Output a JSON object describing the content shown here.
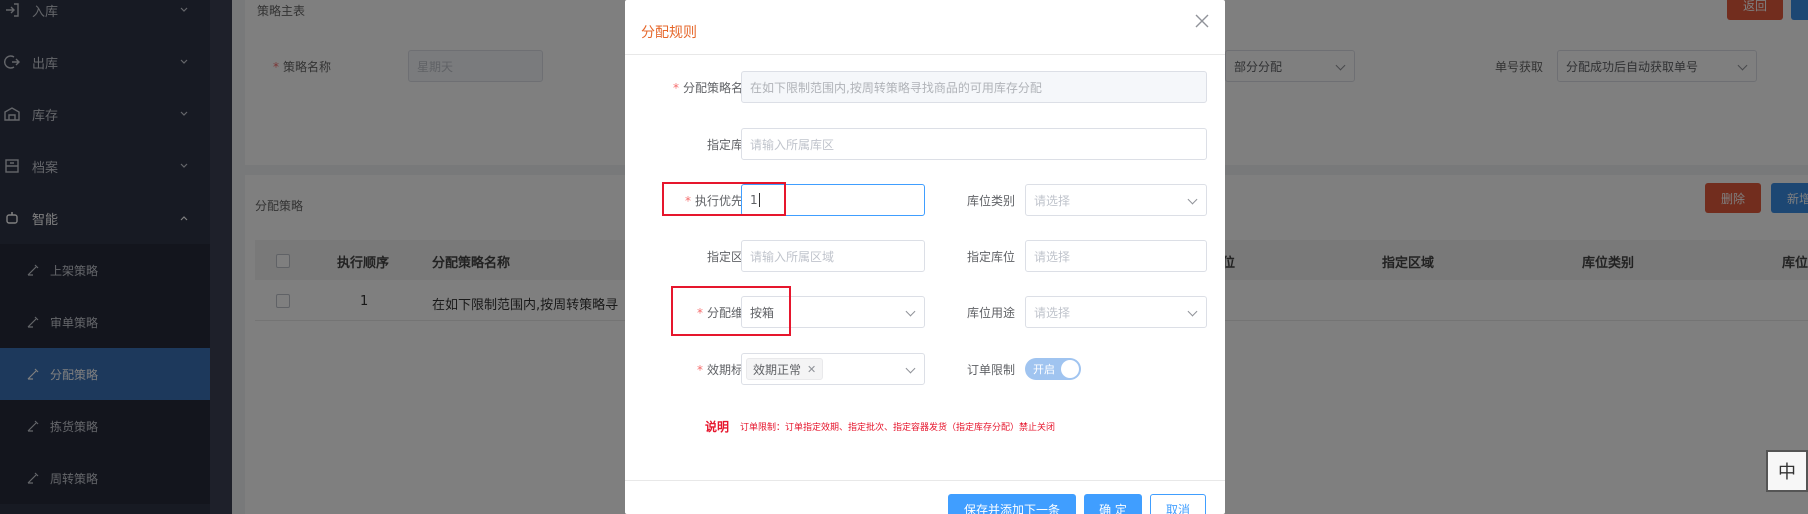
{
  "sidebar": {
    "items": [
      {
        "label": "入库",
        "icon": "enter-icon"
      },
      {
        "label": "出库",
        "icon": "exit-icon"
      },
      {
        "label": "库存",
        "icon": "warehouse-icon"
      },
      {
        "label": "档案",
        "icon": "archive-icon"
      },
      {
        "label": "智能",
        "icon": "smart-icon"
      }
    ],
    "sub_items": [
      {
        "label": "上架策略"
      },
      {
        "label": "审单策略"
      },
      {
        "label": "分配策略",
        "active": true
      },
      {
        "label": "拣货策略"
      },
      {
        "label": "周转策略"
      }
    ]
  },
  "background": {
    "section_title": "策略主表",
    "back_button": "返回",
    "strategy_name_label": "策略名称",
    "strategy_name_value": "星期天",
    "partial_allocation_value": "部分分配",
    "order_no_label": "单号获取",
    "order_no_value": "分配成功后自动获取单号",
    "list_title": "分配策略",
    "delete_button": "删除",
    "new_button": "新增",
    "columns": [
      "执行顺序",
      "分配策略名称",
      "位",
      "指定区域",
      "库位类别",
      "库位"
    ],
    "row": {
      "order": "1",
      "name": "在如下限制范围内,按周转策略寻"
    }
  },
  "modal": {
    "title": "分配规则",
    "fields": {
      "name_label": "分配策略名称",
      "name_value": "在如下限制范围内,按周转策略寻找商品的可用库存分配",
      "zone_label": "指定库区",
      "zone_placeholder": "请输入所属库区",
      "priority_label": "执行优先级",
      "priority_value": "1",
      "location_type_label": "库位类别",
      "location_type_placeholder": "请选择",
      "area_label": "指定区域",
      "area_placeholder": "请输入所属区域",
      "location_label": "指定库位",
      "location_placeholder": "请选择",
      "dimension_label": "分配维度",
      "dimension_value": "按箱",
      "location_use_label": "库位用途",
      "location_use_placeholder": "请选择",
      "expiry_label": "效期标记",
      "expiry_tag": "效期正常",
      "order_limit_label": "订单限制",
      "order_limit_switch": "开启"
    },
    "note_label": "说明",
    "note_text": "订单限制：订单指定效期、指定批次、指定容器发货（指定库存分配）禁止关闭",
    "buttons": {
      "save_next": "保存并添加下一条",
      "confirm": "确 定",
      "cancel": "取消"
    }
  },
  "ime_indicator": "中",
  "colors": {
    "sidebar_bg": "#2f3447",
    "active_item": "#3b73b9",
    "modal_title": "#e6682c",
    "primary": "#409eff",
    "danger": "#e55a3c",
    "annotation_red": "#e6162d"
  }
}
